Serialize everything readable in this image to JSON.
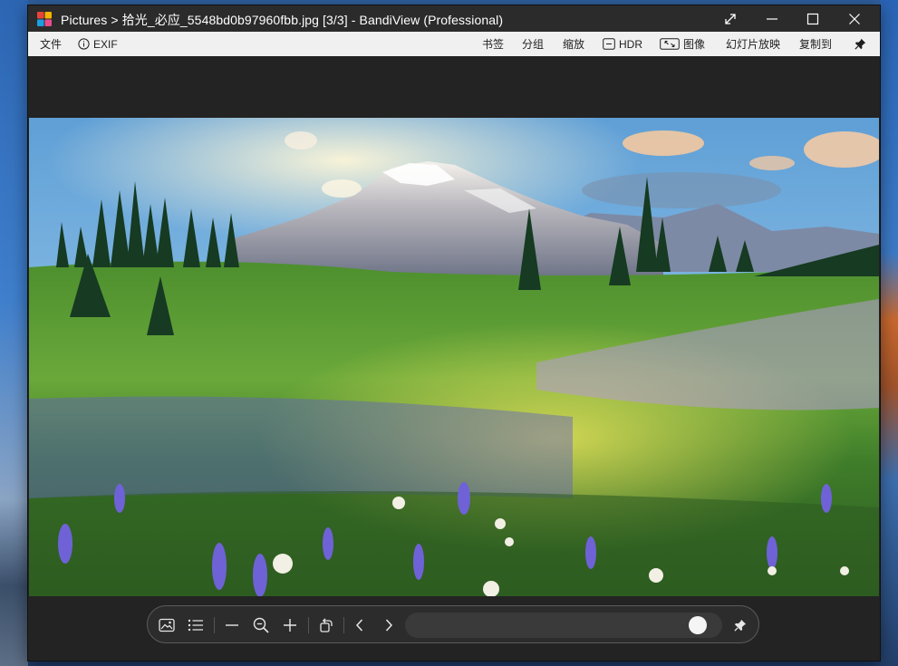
{
  "window": {
    "title": "Pictures > 拾光_必应_5548bd0b97960fbb.jpg [3/3] - BandiView (Professional)"
  },
  "menu_left": {
    "file_label": "文件",
    "exif_label": "EXIF"
  },
  "menu_right": {
    "bookmark_label": "书签",
    "group_label": "分组",
    "zoom_label": "缩放",
    "hdr_label": "HDR",
    "image_label": "图像",
    "slideshow_label": "幻灯片放映",
    "copy_to_label": "复制到"
  },
  "icons": {
    "app": "bandiview-logo-icon",
    "fullscreen": "expand-icon",
    "minimize": "minimize-icon",
    "maximize": "maximize-icon",
    "close": "close-icon",
    "exif": "info-circle-icon",
    "hdr": "hdr-box-icon",
    "image": "resize-box-icon",
    "pin": "pin-icon",
    "thumbnail": "image-icon",
    "list": "list-icon",
    "zoom_out": "minus-icon",
    "zoom_fit": "magnifier-icon",
    "zoom_in": "plus-icon",
    "rotate": "rotate-icon",
    "prev": "chevron-left-icon",
    "next": "chevron-right-icon",
    "toolbar_pin": "pin-icon"
  },
  "slider": {
    "position": 0.96
  },
  "colors": {
    "titlebar": "#2b2b2b",
    "menubar": "#f0f0f0",
    "viewer_bg": "#232323",
    "toolbar_bg": "#2c2c2c"
  }
}
